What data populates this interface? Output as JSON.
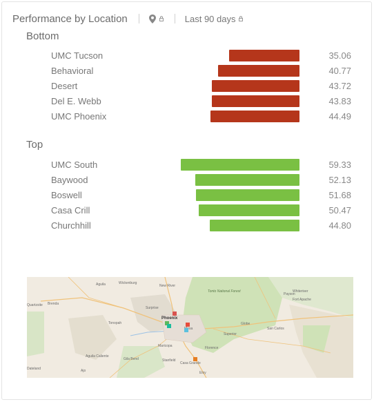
{
  "header": {
    "title": "Performance by Location",
    "period": "Last 90 days",
    "location_icon": "location-pin-icon",
    "lock_icon": "lock-icon"
  },
  "colors": {
    "bottom_bar": "#b5361b",
    "top_bar": "#7ac043"
  },
  "scale_max": 59.33,
  "bottom": {
    "label": "Bottom",
    "rows": [
      {
        "name": "UMC Tucson",
        "value": "35.06",
        "num": 35.06
      },
      {
        "name": "Behavioral",
        "value": "40.77",
        "num": 40.77
      },
      {
        "name": "Desert",
        "value": "43.72",
        "num": 43.72
      },
      {
        "name": "Del E. Webb",
        "value": "43.83",
        "num": 43.83
      },
      {
        "name": "UMC Phoenix",
        "value": "44.49",
        "num": 44.49
      }
    ]
  },
  "top": {
    "label": "Top",
    "rows": [
      {
        "name": "UMC South",
        "value": "59.33",
        "num": 59.33
      },
      {
        "name": "Baywood",
        "value": "52.13",
        "num": 52.13
      },
      {
        "name": "Boswell",
        "value": "51.68",
        "num": 51.68
      },
      {
        "name": "Casa Crill",
        "value": "50.47",
        "num": 50.47
      },
      {
        "name": "Churchhill",
        "value": "44.80",
        "num": 44.8
      }
    ]
  },
  "map": {
    "labels": {
      "phoenix": "Phoenix",
      "mesa": "Mesa",
      "casa_grande": "Casa Grande",
      "tonto": "Tonto National Forest",
      "wickenburg": "Wickenburg",
      "aguila": "Aguila",
      "new_river": "New River",
      "surprise": "Surprise",
      "quartzsite": "Quartzsite",
      "brenda": "Brenda",
      "tonopah": "Tonopah",
      "gila_bend": "Gila Bend",
      "ajo": "Ajo",
      "payson": "Payson",
      "globe": "Globe",
      "san_carlos": "San Carlos",
      "eloy": "Eloy",
      "maricopa": "Maricopa",
      "stanfield": "Stanfield",
      "whiteriver": "Whiteriver",
      "fort_apache": "Fort Apache",
      "dateland": "Dateland",
      "aguila_caliente": "Aguila Caliente",
      "florence": "Florence",
      "superior": "Superior"
    },
    "markers": [
      {
        "name": "red",
        "color": "#d9534f"
      },
      {
        "name": "green",
        "color": "#5cb85c"
      },
      {
        "name": "blue",
        "color": "#5bc0de"
      },
      {
        "name": "teal",
        "color": "#1abc9c"
      },
      {
        "name": "red2",
        "color": "#e74c3c"
      },
      {
        "name": "orange",
        "color": "#e67e22"
      }
    ]
  }
}
